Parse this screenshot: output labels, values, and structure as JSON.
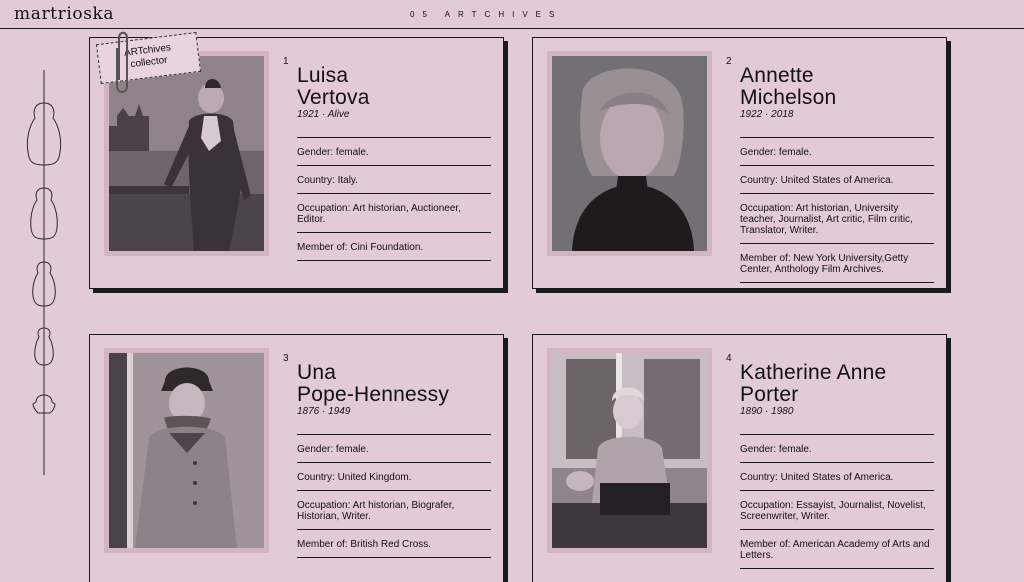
{
  "header": {
    "logo": "martrioska",
    "title": "05 ARTCHIVES"
  },
  "tag": {
    "line1": "ARTchives",
    "line2": "collector"
  },
  "cards": [
    {
      "number": "1",
      "first": "Luisa",
      "last": "Vertova",
      "dates": "1921 · Alive",
      "gender": "Gender: female.",
      "country": "Country: Italy.",
      "occupation": "Occupation: Art historian, Auctioneer, Editor.",
      "member": "Member of: Cini Foundation."
    },
    {
      "number": "2",
      "first": "Annette",
      "last": "Michelson",
      "dates": "1922 · 2018",
      "gender": "Gender: female.",
      "country": "Country: United States of America.",
      "occupation": "Occupation: Art historian, University teacher, Journalist, Art critic, Film critic, Translator, Writer.",
      "member": "Member of: New York University,Getty Center, Anthology Film Archives."
    },
    {
      "number": "3",
      "first": "Una",
      "last": "Pope-Hennessy",
      "dates": "1876 · 1949",
      "gender": "Gender: female.",
      "country": "Country: United Kingdom.",
      "occupation": "Occupation: Art historian, Biografer, Historian, Writer.",
      "member": "Member of: British Red Cross."
    },
    {
      "number": "4",
      "first": "Katherine Anne",
      "last": "Porter",
      "dates": "1890 · 1980",
      "gender": "Gender: female.",
      "country": "Country: United States of America.",
      "occupation": "Occupation: Essayist, Journalist, Novelist, Screenwriter, Writer.",
      "member": "Member of: American Academy of Arts and Letters."
    }
  ],
  "colors": {
    "background": "#e3cad7",
    "ink": "#1a1a1a",
    "photo_frame": "#d2b4c3"
  }
}
